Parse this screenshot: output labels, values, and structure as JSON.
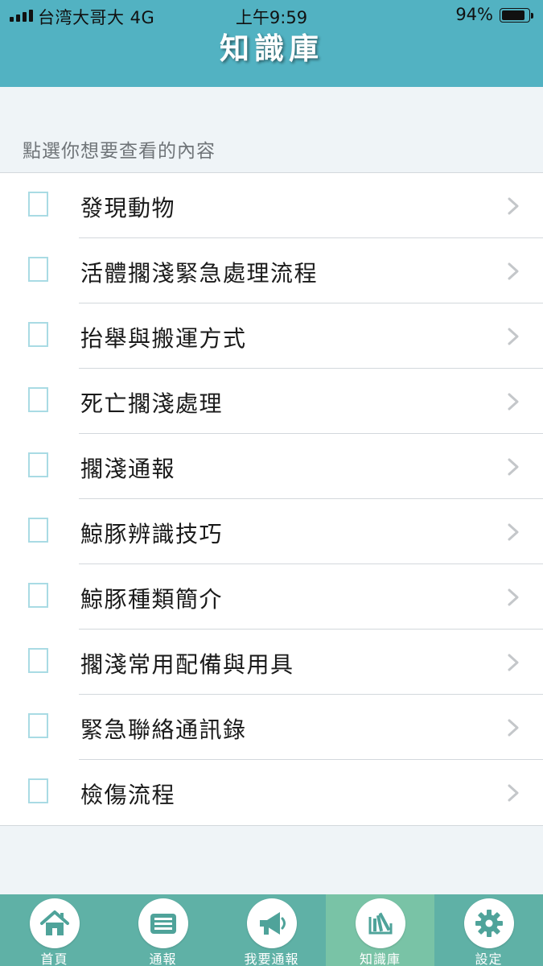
{
  "status_bar": {
    "carrier": "台湾大哥大   4G",
    "time": "上午9:59",
    "battery": "94%",
    "battery_level": 0.94
  },
  "header": {
    "title": "知識庫"
  },
  "section": {
    "label": "點選你想要查看的內容"
  },
  "items": [
    {
      "label": "發現動物"
    },
    {
      "label": "活體擱淺緊急處理流程"
    },
    {
      "label": "抬舉與搬運方式"
    },
    {
      "label": "死亡擱淺處理"
    },
    {
      "label": "擱淺通報"
    },
    {
      "label": "鯨豚辨識技巧"
    },
    {
      "label": "鯨豚種類簡介"
    },
    {
      "label": "擱淺常用配備與用具"
    },
    {
      "label": "緊急聯絡通訊錄"
    },
    {
      "label": "檢傷流程"
    }
  ],
  "tabs": [
    {
      "label": "首頁",
      "icon": "home-icon"
    },
    {
      "label": "通報",
      "icon": "news-icon"
    },
    {
      "label": "我要通報",
      "icon": "megaphone-icon"
    },
    {
      "label": "知識庫",
      "icon": "books-icon",
      "active": true
    },
    {
      "label": "設定",
      "icon": "gear-icon"
    }
  ],
  "colors": {
    "header_bg": "#52b2c2",
    "tabbar_bg": "#5fb1a6",
    "tab_active_bg": "#79c3a6",
    "icon_color": "#4fa39a",
    "checkbox_border": "#a9dbe4"
  }
}
